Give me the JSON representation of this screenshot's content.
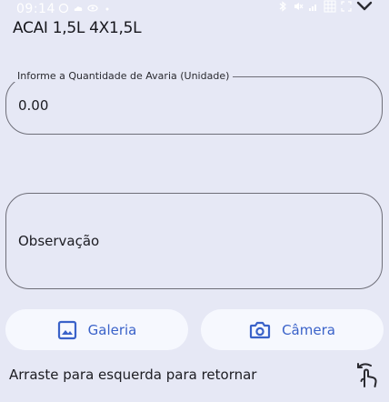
{
  "status_bar": {
    "time": "09:14",
    "left_icons": [
      "data-saver-icon",
      "cloud-icon",
      "eye-icon",
      "dot-icon"
    ],
    "right_icons": [
      "bluetooth-icon",
      "mute-icon",
      "signal-icon",
      "grid-icon",
      "expand-icon",
      "chevron-down-icon"
    ]
  },
  "header": {
    "product_name": "ACAI 1,5L 4X1,5L"
  },
  "form": {
    "quantity": {
      "label": "Informe a Quantidade de Avaria (Unidade)",
      "value": "0.00"
    },
    "observation": {
      "placeholder": "Observação"
    }
  },
  "actions": {
    "gallery_label": "Galeria",
    "camera_label": "Câmera"
  },
  "footer": {
    "hint": "Arraste para esquerda para retornar"
  },
  "colors": {
    "background": "#e6e8f5",
    "accent": "#3a62c9",
    "button_bg": "#f6f8fe"
  }
}
